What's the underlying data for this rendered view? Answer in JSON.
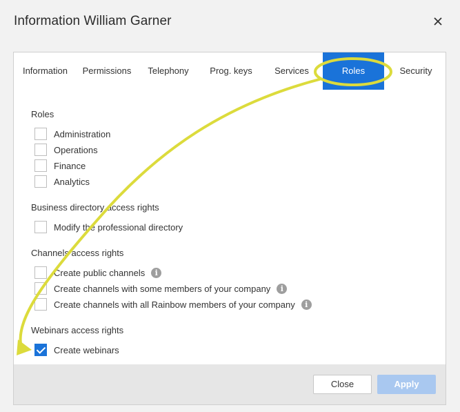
{
  "window": {
    "title": "Information William Garner"
  },
  "tabs": [
    {
      "label": "Information",
      "active": false
    },
    {
      "label": "Permissions",
      "active": false
    },
    {
      "label": "Telephony",
      "active": false
    },
    {
      "label": "Prog. keys",
      "active": false
    },
    {
      "label": "Services",
      "active": false
    },
    {
      "label": "Roles",
      "active": true
    },
    {
      "label": "Security",
      "active": false
    }
  ],
  "roles": {
    "title": "Roles",
    "items": [
      {
        "label": "Administration",
        "checked": false
      },
      {
        "label": "Operations",
        "checked": false
      },
      {
        "label": "Finance",
        "checked": false
      },
      {
        "label": "Analytics",
        "checked": false
      }
    ]
  },
  "directory": {
    "title": "Business directory access rights",
    "items": [
      {
        "label": "Modify the professional directory",
        "checked": false
      }
    ]
  },
  "channels": {
    "title": "Channels access rights",
    "items": [
      {
        "label": "Create public channels",
        "checked": false,
        "info": true
      },
      {
        "label": "Create channels with some members of your company",
        "checked": false,
        "info": true
      },
      {
        "label": "Create channels with all Rainbow members of your company",
        "checked": false,
        "info": true
      }
    ]
  },
  "webinars": {
    "title": "Webinars access rights",
    "items": [
      {
        "label": "Create webinars",
        "checked": true
      }
    ]
  },
  "footer": {
    "close_label": "Close",
    "apply_label": "Apply"
  },
  "icons": {
    "info_glyph": "i",
    "close": "close-icon",
    "info": "info-icon"
  },
  "colors": {
    "accent": "#1a73d9",
    "annotation": "#dcdb3c",
    "apply_disabled": "#a9c8f0"
  }
}
